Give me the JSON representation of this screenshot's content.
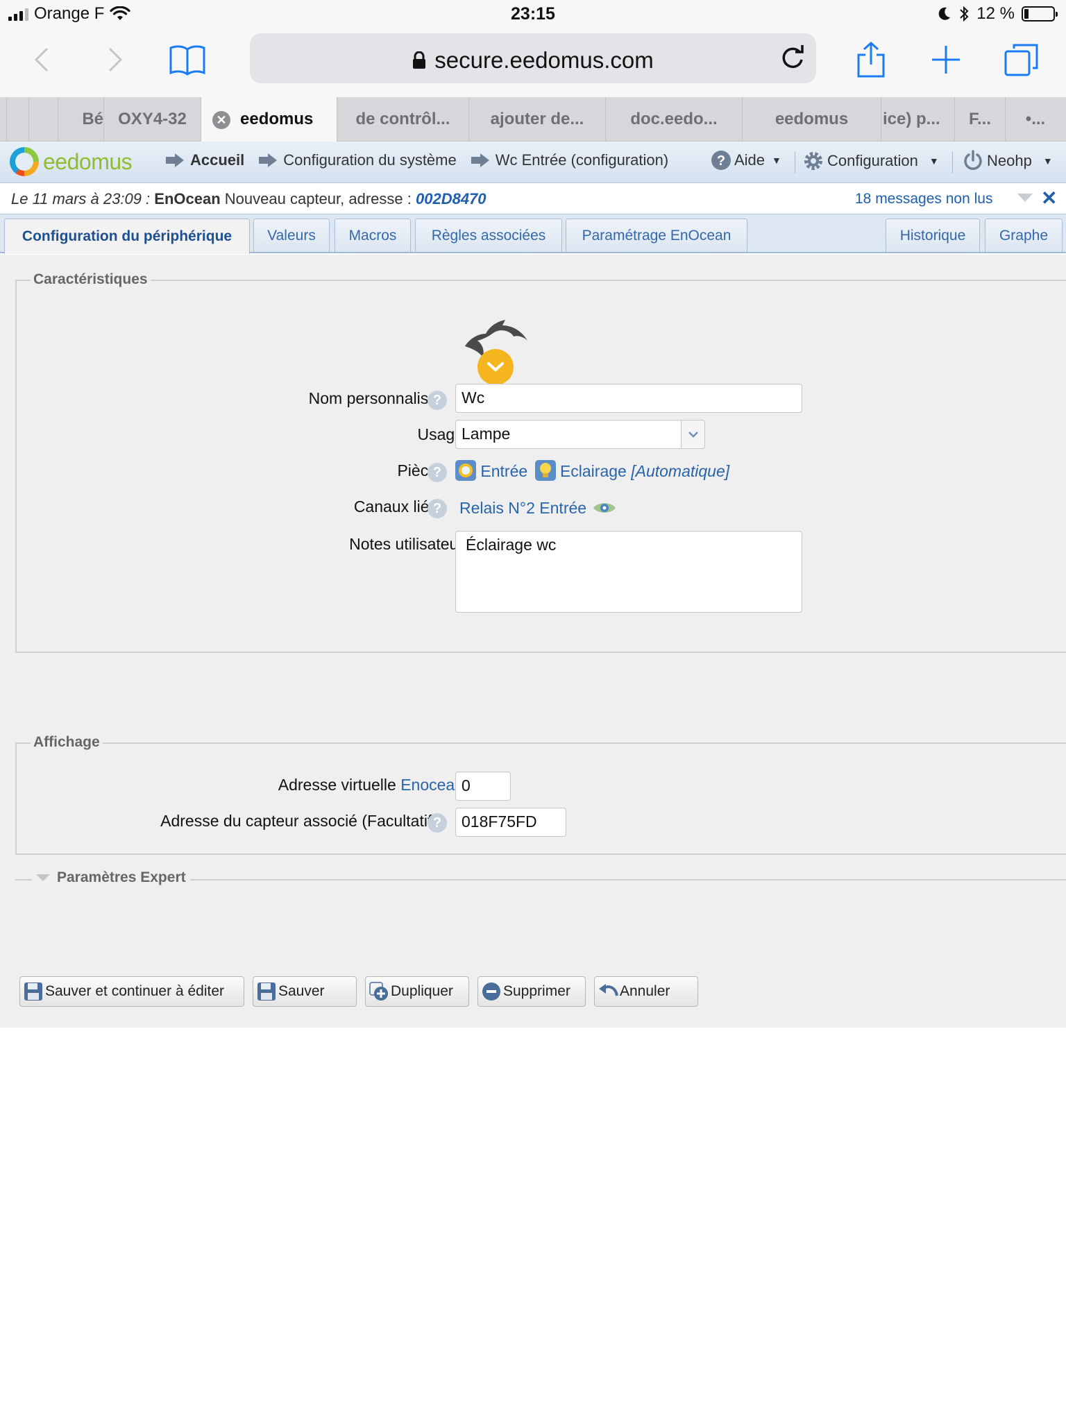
{
  "status_bar": {
    "carrier": "Orange F",
    "time": "23:15",
    "battery": "12 %",
    "battery_level": 0.12
  },
  "browser": {
    "url": "secure.eedomus.com",
    "icons": [
      "back-icon",
      "forward-icon",
      "bookmarks-icon",
      "lock-icon",
      "reload-icon",
      "share-icon",
      "new-tab-icon",
      "tabs-icon"
    ],
    "tabs": [
      {
        "label": ""
      },
      {
        "label": ""
      },
      {
        "label": "Bé"
      },
      {
        "label": "OXY4-32"
      },
      {
        "label": "eedomus",
        "active": true
      },
      {
        "label": "de contrôl..."
      },
      {
        "label": "ajouter de..."
      },
      {
        "label": "doc.eedo..."
      },
      {
        "label": "eedomus"
      },
      {
        "label": "ice) p..."
      },
      {
        "label": "F..."
      },
      {
        "label": "•..."
      }
    ]
  },
  "app": {
    "logo": "eedomus",
    "breadcrumbs": [
      "Accueil",
      "Configuration du système",
      "Wc Entrée (configuration)"
    ],
    "menu": {
      "help": "Aide",
      "config": "Configuration",
      "user": "Neohp"
    }
  },
  "notification": {
    "date": "Le 11 mars à 23:09 :",
    "source": "EnOcean",
    "message": "Nouveau capteur, adresse :",
    "address": "002D8470",
    "unread": "18 messages non lus",
    "close": "✕"
  },
  "tabs": [
    {
      "label": "Configuration du périphérique",
      "active": true
    },
    {
      "label": "Valeurs"
    },
    {
      "label": "Macros"
    },
    {
      "label": "Règles associées"
    },
    {
      "label": "Paramétrage EnOcean"
    },
    {
      "label": "Historique"
    },
    {
      "label": "Graphe"
    }
  ],
  "characteristics": {
    "legend": "Caractéristiques",
    "name_label": "Nom personnalisé",
    "name_value": "Wc",
    "usage_label": "Usage",
    "usage_value": "Lampe",
    "room_label": "Pièce",
    "room_value": "Entrée",
    "room_usage": "Eclairage",
    "room_auto": "[Automatique]",
    "channels_label": "Canaux liés",
    "channels_value": "Relais N°2 Entrée",
    "notes_label": "Notes utilisateur",
    "notes_value": "Éclairage wc"
  },
  "display": {
    "legend": "Affichage",
    "virtual_label": "Adresse virtuelle",
    "virtual_link": "Enocean",
    "virtual_value": "0",
    "sensor_label": "Adresse du capteur associé (Facultatif)",
    "sensor_value": "018F75FD"
  },
  "expert": {
    "legend": "Paramètres Expert"
  },
  "buttons": {
    "save_continue": "Sauver et continuer à éditer",
    "save": "Sauver",
    "duplicate": "Dupliquer",
    "delete": "Supprimer",
    "cancel": "Annuler"
  },
  "colors": {
    "link": "#2864ad",
    "tab_text": "#3568a8",
    "logo_green": "#8dbe2c",
    "badge_orange": "#f5b51e"
  }
}
